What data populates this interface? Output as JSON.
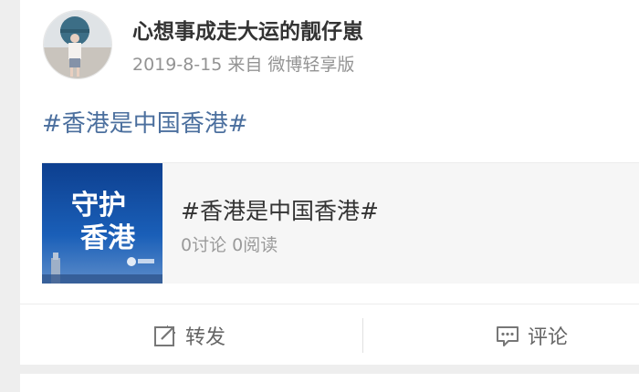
{
  "post": {
    "author": {
      "name": "心想事成走大运的靓仔崽"
    },
    "meta": {
      "date": "2019-8-15",
      "source": "来自 微博轻享版"
    },
    "text": "#香港是中国香港#",
    "topic_card": {
      "thumb_text_line1": "守护",
      "thumb_text_line2": "香港",
      "title": "#香港是中国香港#",
      "stats": "0讨论 0阅读"
    },
    "actions": {
      "repost_label": "转发",
      "comment_label": "评论"
    }
  },
  "colors": {
    "link": "#4b6f9e",
    "text": "#333333",
    "muted": "#939393",
    "background": "#eeeeee",
    "card": "#ffffff",
    "thumb_blue": "#1552a6"
  },
  "icons": {
    "repost": "share-arrow-icon",
    "comment": "speech-bubble-icon"
  }
}
